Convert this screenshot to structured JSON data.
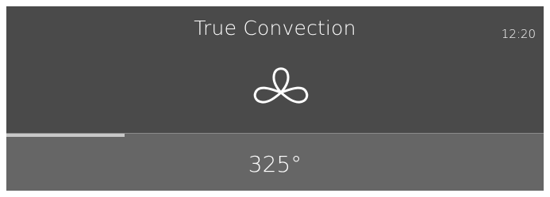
{
  "header": {
    "mode_title": "True Convection",
    "clock": "12:20"
  },
  "mode_icon": "fan-icon",
  "progress": {
    "fraction": 0.22
  },
  "temperature": {
    "display": "325°"
  },
  "colors": {
    "top_panel": "#4a4a4a",
    "bottom_panel": "#666666",
    "progress_fill": "#c8c8c8",
    "text": "#ffffff"
  }
}
